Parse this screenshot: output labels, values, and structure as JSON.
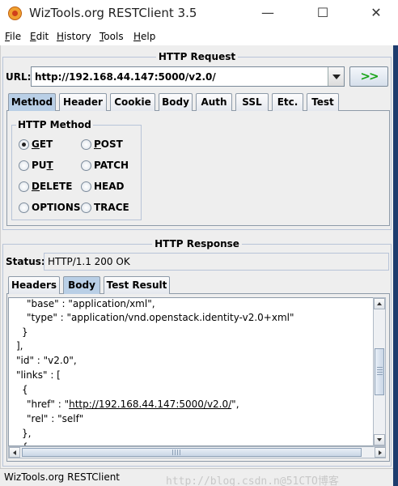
{
  "window": {
    "title": "WizTools.org RESTClient 3.5",
    "minimize": "—",
    "maximize": "☐",
    "close": "✕"
  },
  "menu": [
    {
      "label": "File",
      "mnemonic": "F",
      "rest": "ile"
    },
    {
      "label": "Edit",
      "mnemonic": "E",
      "rest": "dit"
    },
    {
      "label": "History",
      "mnemonic": "H",
      "rest": "istory"
    },
    {
      "label": "Tools",
      "mnemonic": "T",
      "rest": "ools"
    },
    {
      "label": "Help",
      "mnemonic": "H",
      "rest": "elp"
    }
  ],
  "request": {
    "section_title": "HTTP Request",
    "url_label": "URL:",
    "url_value": "http://192.168.44.147:5000/v2.0/",
    "go_label": ">>",
    "tabs": [
      "Method",
      "Header",
      "Cookie",
      "Body",
      "Auth",
      "SSL",
      "Etc.",
      "Test"
    ],
    "active_tab": "Method",
    "method_group_title": "HTTP Method",
    "methods": [
      {
        "label": "GET",
        "mnemonic": "G",
        "rest": "ET",
        "checked": true
      },
      {
        "label": "POST",
        "mnemonic": "P",
        "rest": "OST",
        "checked": false
      },
      {
        "label": "PUT",
        "mnemonic": "T",
        "prefix": "PU",
        "checked": false
      },
      {
        "label": "PATCH",
        "checked": false
      },
      {
        "label": "DELETE",
        "mnemonic": "D",
        "rest": "ELETE",
        "checked": false
      },
      {
        "label": "HEAD",
        "checked": false
      },
      {
        "label": "OPTIONS",
        "checked": false
      },
      {
        "label": "TRACE",
        "checked": false
      }
    ]
  },
  "response": {
    "section_title": "HTTP Response",
    "status_label": "Status:",
    "status_value": "HTTP/1.1 200 OK",
    "tabs": [
      "Headers",
      "Body",
      "Test Result"
    ],
    "active_tab": "Body",
    "body_lines": [
      "\"base\" : \"application/xml\",",
      "\"type\" : \"application/vnd.openstack.identity-v2.0+xml\"",
      "}",
      "],",
      "\"id\" : \"v2.0\",",
      "\"links\" : [",
      "{",
      "\"href\" : \"",
      "http://192.168.44.147:5000/v2.0/",
      "\",",
      "\"rel\" : \"self\"",
      "},",
      "{"
    ]
  },
  "statusbar": {
    "text": "WizTools.org RESTClient",
    "watermark": "http://blog.csdn.n@51CTO博客"
  }
}
